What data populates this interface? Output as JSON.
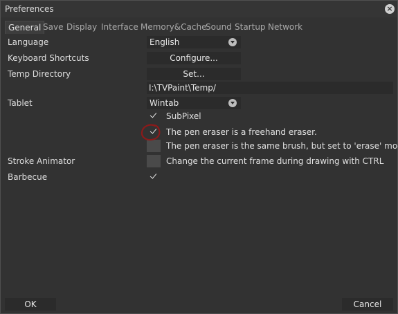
{
  "window": {
    "title": "Preferences",
    "close_icon": "close-icon"
  },
  "tabs": [
    {
      "label": "General",
      "active": true
    },
    {
      "label": "Save"
    },
    {
      "label": "Display"
    },
    {
      "label": "Interface"
    },
    {
      "label": "Memory&Cache"
    },
    {
      "label": "Sound"
    },
    {
      "label": "Startup"
    },
    {
      "label": "Network"
    }
  ],
  "settings": {
    "language": {
      "label": "Language",
      "value": "English"
    },
    "shortcuts": {
      "label": "Keyboard Shortcuts",
      "button": "Configure..."
    },
    "temp": {
      "label": "Temp Directory",
      "button": "Set...",
      "path": "I:\\TVPaint\\Temp/"
    },
    "tablet": {
      "label": "Tablet",
      "value": "Wintab",
      "options": [
        {
          "label": "SubPixel",
          "checked": true
        },
        {
          "label": "The pen eraser is a freehand eraser.",
          "checked": true
        },
        {
          "label": "The pen eraser is the same brush, but set to 'erase' mode.",
          "checked": false
        }
      ]
    },
    "stroke_animator": {
      "label": "Stroke Animator",
      "option": "Change the current frame during drawing with CTRL",
      "checked": false
    },
    "barbecue": {
      "label": "Barbecue",
      "checked": true
    }
  },
  "footer": {
    "ok": "OK",
    "cancel": "Cancel"
  },
  "colors": {
    "background": "#323232",
    "field": "#2b2b2b",
    "annotation": "#8b1a1a"
  }
}
